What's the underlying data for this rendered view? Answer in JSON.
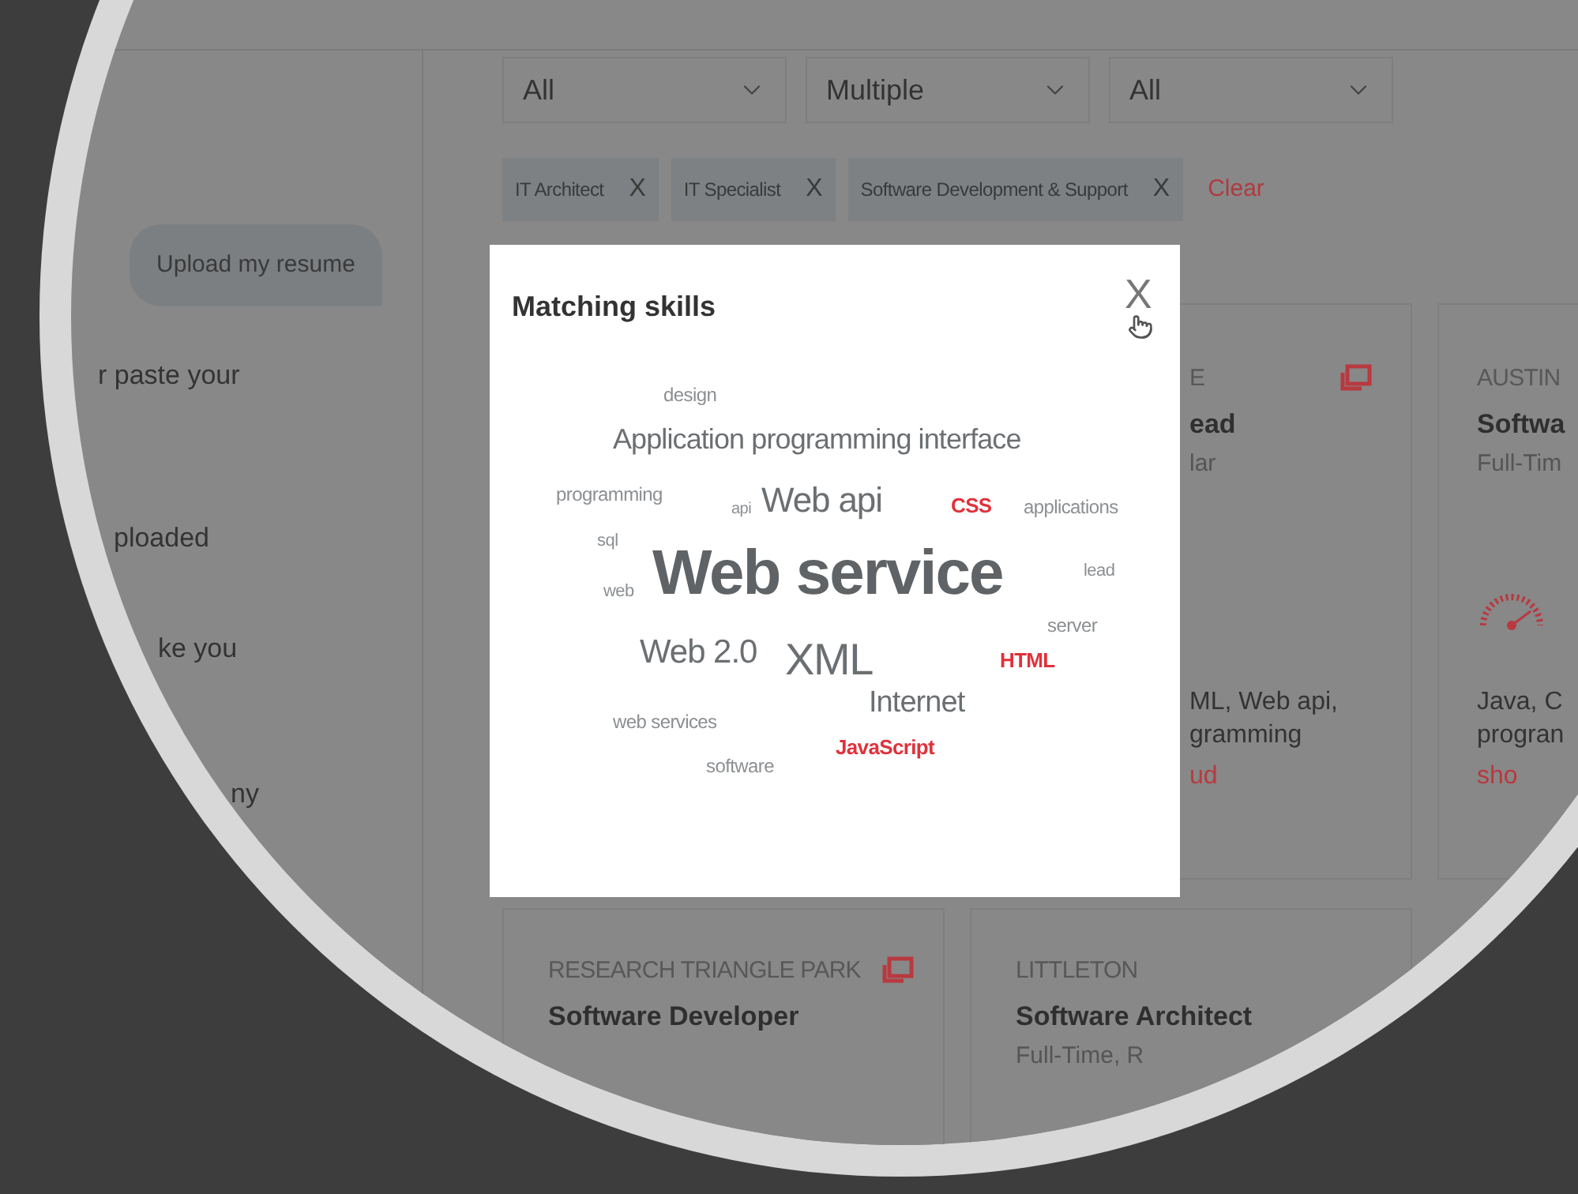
{
  "sidebar": {
    "upload_button": "Upload my resume",
    "texts": [
      "r paste your",
      "ploaded",
      "ke you",
      "ny"
    ]
  },
  "filters": [
    {
      "value": "All"
    },
    {
      "value": "Multiple"
    },
    {
      "value": "All"
    }
  ],
  "tags": [
    {
      "label": "IT Architect",
      "remove": "X"
    },
    {
      "label": "IT Specialist",
      "remove": "X"
    },
    {
      "label": "Software Development & Support",
      "remove": "X"
    }
  ],
  "clear_link": "Clear",
  "cards": [
    {
      "kind": "partial",
      "location": "E",
      "title": "ead",
      "type": "lar",
      "skills": [
        "ML, Web api,",
        "gramming"
      ],
      "link": "ud"
    },
    {
      "kind": "gauge",
      "location": "AUSTIN",
      "title": "Softwa",
      "type": "Full-Tim",
      "skills": [
        "Java, C",
        "progran"
      ],
      "link": "sho"
    },
    {
      "kind": "icon",
      "location": "RESEARCH TRIANGLE PARK",
      "title": "Software Developer"
    },
    {
      "kind": "plain",
      "location": "LITTLETON",
      "title": "Software Architect",
      "type": "Full-Time, R"
    }
  ],
  "modal": {
    "title": "Matching skills",
    "close": "X",
    "words": [
      {
        "text": "design",
        "color": "#8c8f92"
      },
      {
        "text": "Application programming interface",
        "color": "#6b6f72"
      },
      {
        "text": "programming",
        "color": "#8c8f92"
      },
      {
        "text": "api",
        "color": "#8c8f92"
      },
      {
        "text": "Web api",
        "color": "#6b6f72"
      },
      {
        "text": "CSS",
        "color": "#e0313b"
      },
      {
        "text": "applications",
        "color": "#8c8f92"
      },
      {
        "text": "sql",
        "color": "#8c8f92"
      },
      {
        "text": "web",
        "color": "#8c8f92"
      },
      {
        "text": "Web service",
        "color": "#5f6366"
      },
      {
        "text": "lead",
        "color": "#8c8f92"
      },
      {
        "text": "server",
        "color": "#8c8f92"
      },
      {
        "text": "Web 2.0",
        "color": "#6b6f72"
      },
      {
        "text": "XML",
        "color": "#6b6f72"
      },
      {
        "text": "HTML",
        "color": "#e0313b"
      },
      {
        "text": "Internet",
        "color": "#6b6f72"
      },
      {
        "text": "web services",
        "color": "#8c8f92"
      },
      {
        "text": "JavaScript",
        "color": "#e0313b"
      },
      {
        "text": "software",
        "color": "#8c8f92"
      }
    ]
  }
}
